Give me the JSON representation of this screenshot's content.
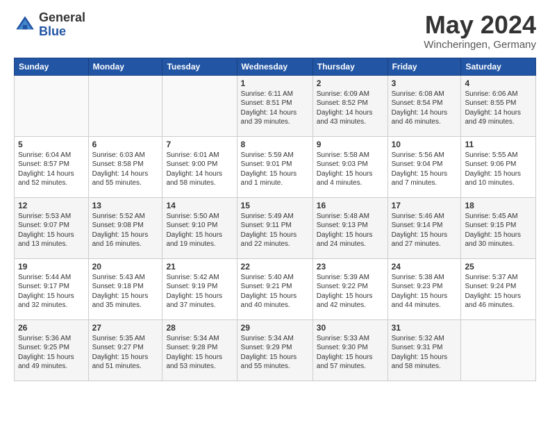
{
  "header": {
    "logo_general": "General",
    "logo_blue": "Blue",
    "month_title": "May 2024",
    "subtitle": "Wincheringen, Germany"
  },
  "days_of_week": [
    "Sunday",
    "Monday",
    "Tuesday",
    "Wednesday",
    "Thursday",
    "Friday",
    "Saturday"
  ],
  "weeks": [
    [
      {
        "day": "",
        "content": ""
      },
      {
        "day": "",
        "content": ""
      },
      {
        "day": "",
        "content": ""
      },
      {
        "day": "1",
        "content": "Sunrise: 6:11 AM\nSunset: 8:51 PM\nDaylight: 14 hours\nand 39 minutes."
      },
      {
        "day": "2",
        "content": "Sunrise: 6:09 AM\nSunset: 8:52 PM\nDaylight: 14 hours\nand 43 minutes."
      },
      {
        "day": "3",
        "content": "Sunrise: 6:08 AM\nSunset: 8:54 PM\nDaylight: 14 hours\nand 46 minutes."
      },
      {
        "day": "4",
        "content": "Sunrise: 6:06 AM\nSunset: 8:55 PM\nDaylight: 14 hours\nand 49 minutes."
      }
    ],
    [
      {
        "day": "5",
        "content": "Sunrise: 6:04 AM\nSunset: 8:57 PM\nDaylight: 14 hours\nand 52 minutes."
      },
      {
        "day": "6",
        "content": "Sunrise: 6:03 AM\nSunset: 8:58 PM\nDaylight: 14 hours\nand 55 minutes."
      },
      {
        "day": "7",
        "content": "Sunrise: 6:01 AM\nSunset: 9:00 PM\nDaylight: 14 hours\nand 58 minutes."
      },
      {
        "day": "8",
        "content": "Sunrise: 5:59 AM\nSunset: 9:01 PM\nDaylight: 15 hours\nand 1 minute."
      },
      {
        "day": "9",
        "content": "Sunrise: 5:58 AM\nSunset: 9:03 PM\nDaylight: 15 hours\nand 4 minutes."
      },
      {
        "day": "10",
        "content": "Sunrise: 5:56 AM\nSunset: 9:04 PM\nDaylight: 15 hours\nand 7 minutes."
      },
      {
        "day": "11",
        "content": "Sunrise: 5:55 AM\nSunset: 9:06 PM\nDaylight: 15 hours\nand 10 minutes."
      }
    ],
    [
      {
        "day": "12",
        "content": "Sunrise: 5:53 AM\nSunset: 9:07 PM\nDaylight: 15 hours\nand 13 minutes."
      },
      {
        "day": "13",
        "content": "Sunrise: 5:52 AM\nSunset: 9:08 PM\nDaylight: 15 hours\nand 16 minutes."
      },
      {
        "day": "14",
        "content": "Sunrise: 5:50 AM\nSunset: 9:10 PM\nDaylight: 15 hours\nand 19 minutes."
      },
      {
        "day": "15",
        "content": "Sunrise: 5:49 AM\nSunset: 9:11 PM\nDaylight: 15 hours\nand 22 minutes."
      },
      {
        "day": "16",
        "content": "Sunrise: 5:48 AM\nSunset: 9:13 PM\nDaylight: 15 hours\nand 24 minutes."
      },
      {
        "day": "17",
        "content": "Sunrise: 5:46 AM\nSunset: 9:14 PM\nDaylight: 15 hours\nand 27 minutes."
      },
      {
        "day": "18",
        "content": "Sunrise: 5:45 AM\nSunset: 9:15 PM\nDaylight: 15 hours\nand 30 minutes."
      }
    ],
    [
      {
        "day": "19",
        "content": "Sunrise: 5:44 AM\nSunset: 9:17 PM\nDaylight: 15 hours\nand 32 minutes."
      },
      {
        "day": "20",
        "content": "Sunrise: 5:43 AM\nSunset: 9:18 PM\nDaylight: 15 hours\nand 35 minutes."
      },
      {
        "day": "21",
        "content": "Sunrise: 5:42 AM\nSunset: 9:19 PM\nDaylight: 15 hours\nand 37 minutes."
      },
      {
        "day": "22",
        "content": "Sunrise: 5:40 AM\nSunset: 9:21 PM\nDaylight: 15 hours\nand 40 minutes."
      },
      {
        "day": "23",
        "content": "Sunrise: 5:39 AM\nSunset: 9:22 PM\nDaylight: 15 hours\nand 42 minutes."
      },
      {
        "day": "24",
        "content": "Sunrise: 5:38 AM\nSunset: 9:23 PM\nDaylight: 15 hours\nand 44 minutes."
      },
      {
        "day": "25",
        "content": "Sunrise: 5:37 AM\nSunset: 9:24 PM\nDaylight: 15 hours\nand 46 minutes."
      }
    ],
    [
      {
        "day": "26",
        "content": "Sunrise: 5:36 AM\nSunset: 9:25 PM\nDaylight: 15 hours\nand 49 minutes."
      },
      {
        "day": "27",
        "content": "Sunrise: 5:35 AM\nSunset: 9:27 PM\nDaylight: 15 hours\nand 51 minutes."
      },
      {
        "day": "28",
        "content": "Sunrise: 5:34 AM\nSunset: 9:28 PM\nDaylight: 15 hours\nand 53 minutes."
      },
      {
        "day": "29",
        "content": "Sunrise: 5:34 AM\nSunset: 9:29 PM\nDaylight: 15 hours\nand 55 minutes."
      },
      {
        "day": "30",
        "content": "Sunrise: 5:33 AM\nSunset: 9:30 PM\nDaylight: 15 hours\nand 57 minutes."
      },
      {
        "day": "31",
        "content": "Sunrise: 5:32 AM\nSunset: 9:31 PM\nDaylight: 15 hours\nand 58 minutes."
      },
      {
        "day": "",
        "content": ""
      }
    ]
  ]
}
